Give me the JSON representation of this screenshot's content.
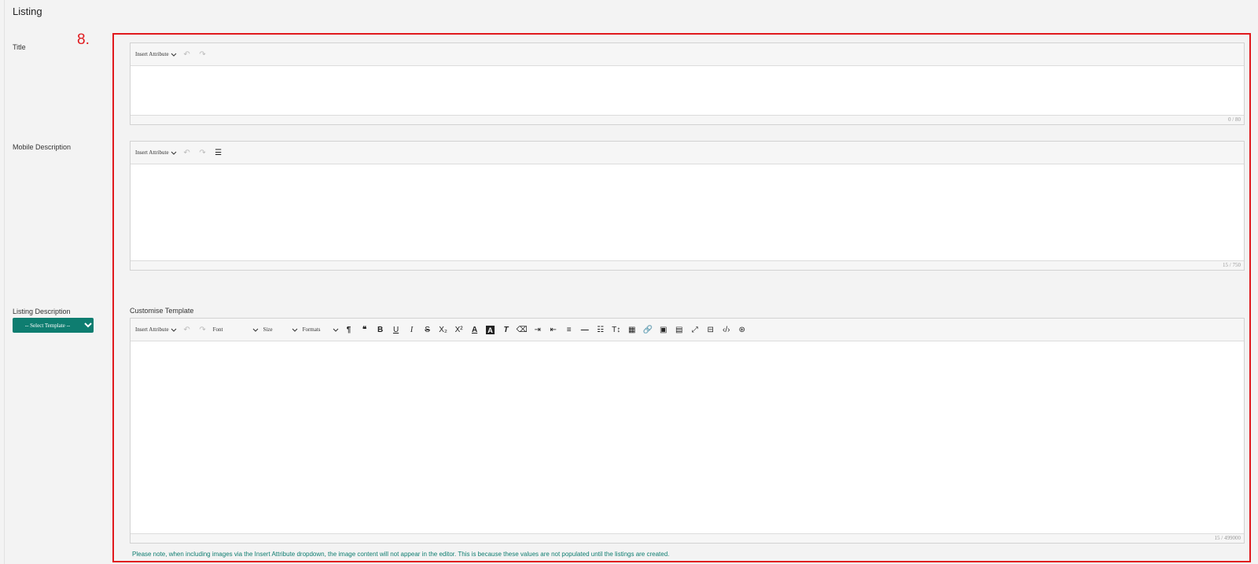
{
  "section": {
    "title": "Listing"
  },
  "step_marker": "8.",
  "labels": {
    "title": "Title",
    "mobile_description": "Mobile Description",
    "listing_description": "Listing Description",
    "customise_template": "Customise Template"
  },
  "template_select": {
    "value": "-- Select Template --"
  },
  "editors": {
    "title": {
      "insert_attribute": "Insert Attribute",
      "counter": "0 / 80"
    },
    "mobile": {
      "insert_attribute": "Insert Attribute",
      "counter": "15 / 750"
    },
    "listing": {
      "insert_attribute": "Insert Attribute",
      "font": "Font",
      "size": "Size",
      "formats": "Formats",
      "counter": "15 / 499000"
    }
  },
  "note": "Please note, when including images via the Insert Attribute dropdown, the image content will not appear in the editor. This is because these values are not populated until the listings are created.",
  "colors": {
    "accent": "#0e7d70",
    "highlight_box": "#e0191d"
  }
}
